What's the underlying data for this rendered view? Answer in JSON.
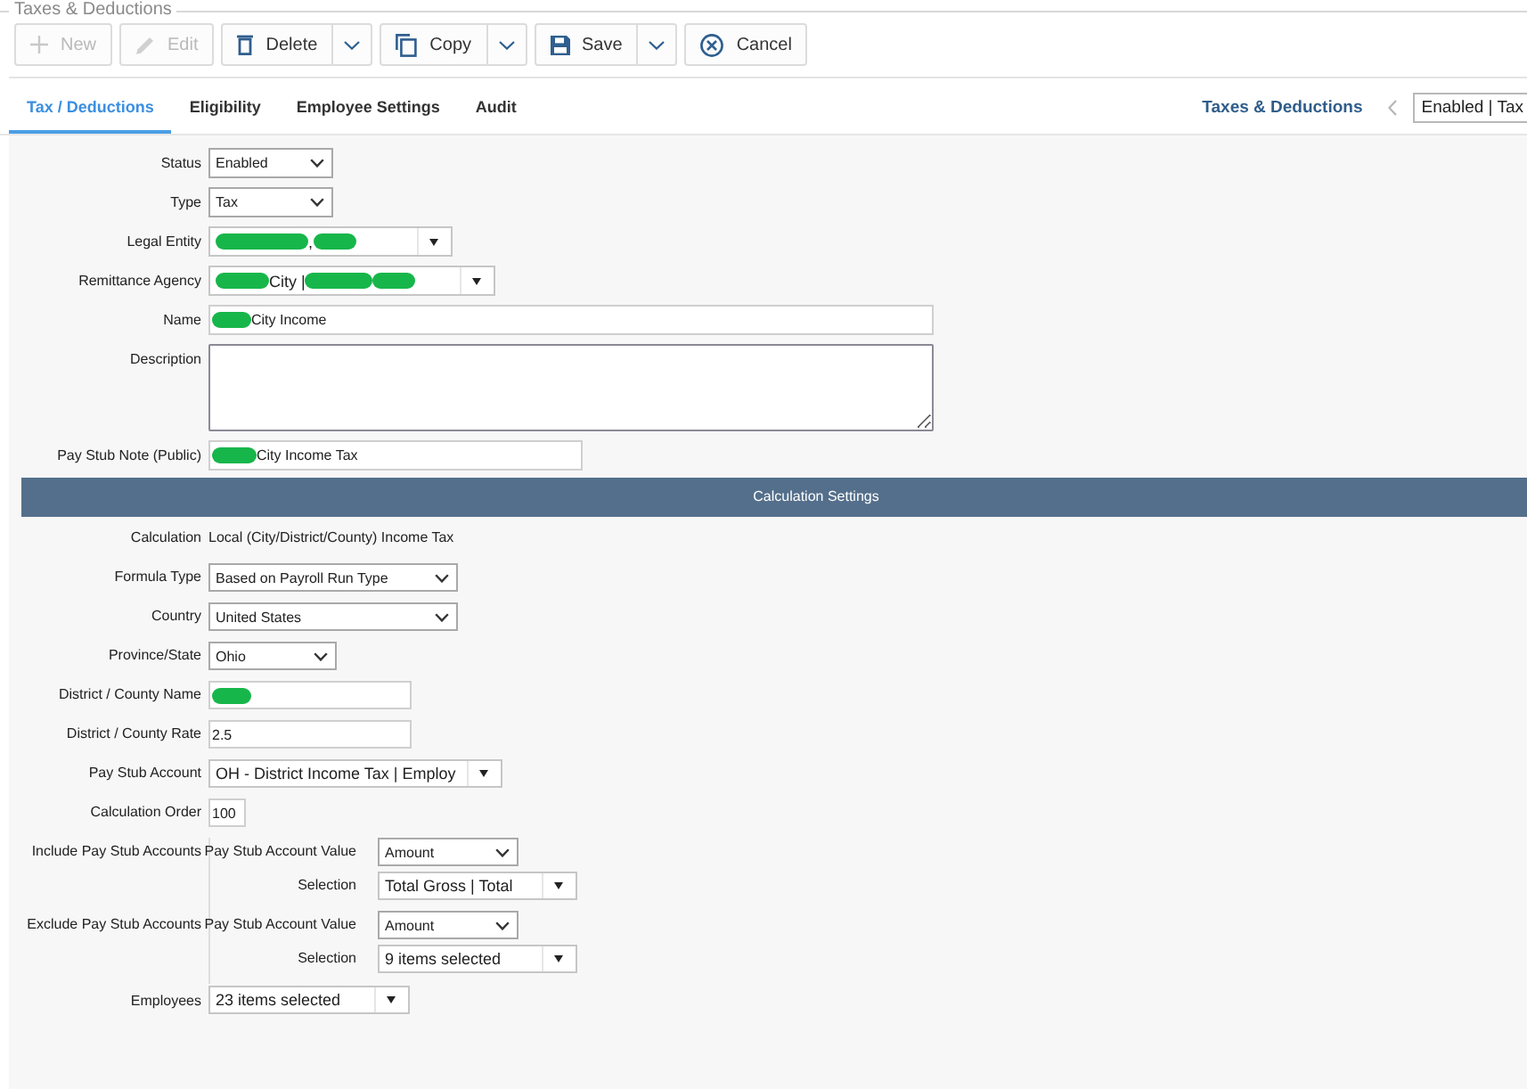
{
  "legend": "Taxes & Deductions",
  "toolbar": [
    {
      "kind": "new",
      "label": "New",
      "disabled": true,
      "split": false
    },
    {
      "kind": "edit",
      "label": "Edit",
      "disabled": true,
      "split": false
    },
    {
      "kind": "delete",
      "label": "Delete",
      "disabled": false,
      "split": true
    },
    {
      "kind": "copy",
      "label": "Copy",
      "disabled": false,
      "split": true
    },
    {
      "kind": "save",
      "label": "Save",
      "disabled": false,
      "split": true
    },
    {
      "kind": "cancel",
      "label": "Cancel",
      "disabled": false,
      "split": false
    }
  ],
  "tabs": [
    {
      "label": "Tax / Deductions",
      "selected": true
    },
    {
      "label": "Eligibility",
      "selected": false
    },
    {
      "label": "Employee Settings",
      "selected": false
    },
    {
      "label": "Audit",
      "selected": false
    }
  ],
  "breadcrumb": {
    "link": "Taxes & Deductions",
    "current": "Enabled | Tax"
  },
  "fields": [
    {
      "label": "Status",
      "kind": "select",
      "value": "Enabled"
    },
    {
      "label": "Type",
      "kind": "select",
      "value": "Tax"
    },
    {
      "label": "Legal Entity",
      "kind": "dropdown",
      "parts": [
        {
          "kind": "redacted"
        },
        {
          "kind": "text",
          "text": ","
        },
        {
          "kind": "redacted"
        }
      ]
    },
    {
      "label": "Remittance Agency",
      "kind": "dropdown",
      "parts": [
        {
          "kind": "redacted"
        },
        {
          "kind": "text",
          "text": "City |"
        },
        {
          "kind": "redacted"
        },
        {
          "kind": "redacted"
        }
      ]
    },
    {
      "label": "Name",
      "kind": "input",
      "parts": [
        {
          "kind": "redacted"
        },
        {
          "kind": "text",
          "text": "City Income"
        }
      ]
    },
    {
      "label": "Description",
      "kind": "textarea"
    },
    {
      "label": "Pay Stub Note (Public)",
      "kind": "input",
      "parts": [
        {
          "kind": "redacted"
        },
        {
          "kind": "text",
          "text": "City Income Tax"
        }
      ]
    }
  ],
  "section": {
    "title": "Calculation Settings"
  },
  "calculation": [
    {
      "label": "Calculation",
      "kind": "text",
      "value": "Local (City/District/County) Income Tax"
    },
    {
      "label": "Formula Type",
      "kind": "select",
      "value": "Based on Payroll Run Type"
    },
    {
      "label": "Country",
      "kind": "select",
      "value": "United States"
    },
    {
      "label": "Province/State",
      "kind": "select",
      "value": "Ohio"
    },
    {
      "label": "District / County Name",
      "kind": "input",
      "parts": [
        {
          "kind": "redacted"
        }
      ]
    },
    {
      "label": "District / County Rate",
      "kind": "input",
      "value": "2.5"
    },
    {
      "label": "Pay Stub Account",
      "kind": "dropdown",
      "value": "OH - District Income Tax | Employ"
    },
    {
      "label": "Calculation Order",
      "kind": "input",
      "value": "100"
    }
  ],
  "account_groups": [
    {
      "label": "Include Pay Stub Accounts",
      "rows": [
        {
          "label": "Pay Stub Account Value",
          "kind": "select",
          "value": "Amount"
        },
        {
          "label": "Selection",
          "kind": "dropdown",
          "value": "Total Gross | Total"
        }
      ]
    },
    {
      "label": "Exclude Pay Stub Accounts",
      "rows": [
        {
          "label": "Pay Stub Account Value",
          "kind": "select",
          "value": "Amount"
        },
        {
          "label": "Selection",
          "kind": "dropdown",
          "value": "9 items selected"
        }
      ]
    }
  ],
  "employees": {
    "label": "Employees",
    "kind": "dropdown",
    "value": "23 items selected"
  }
}
